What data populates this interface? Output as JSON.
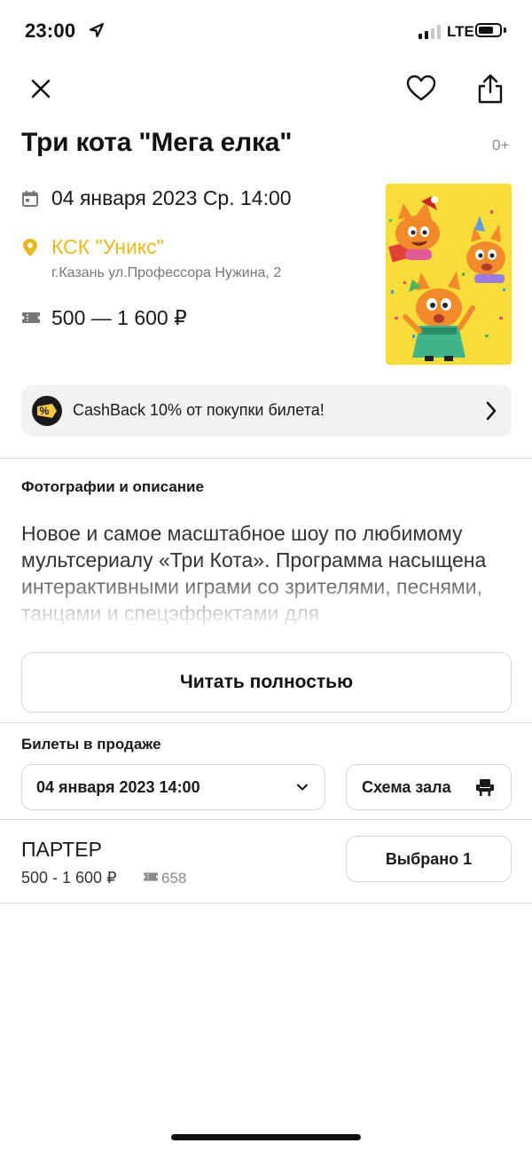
{
  "status_bar": {
    "time": "23:00",
    "network": "LTE"
  },
  "event": {
    "title": "Три кота \"Мега елка\"",
    "age_rating": "0+",
    "date": "04 января 2023 Ср. 14:00",
    "venue_name": "КСК \"Уникс\"",
    "venue_address": "г.Казань ул.Профессора Нужина, 2",
    "price_range": "500 — 1 600 ₽"
  },
  "cashback": {
    "text": "CashBack 10% от покупки билета!",
    "badge": "%"
  },
  "description": {
    "section_title": "Фотографии и описание",
    "text": "Новое и самое масштабное шоу по любимому мультсериалу «Три Кота». Программа насыщена интерактивными играми со зрителями, песнями, танцами и спецэффектами для",
    "read_more_label": "Читать полностью"
  },
  "tickets": {
    "section_title": "Билеты в продаже",
    "selected_date": "04 января 2023 14:00",
    "scheme_label": "Схема зала",
    "zones": [
      {
        "name": "ПАРТЕР",
        "price": "500 - 1 600 ₽",
        "available": "658",
        "button_label": "Выбрано 1"
      }
    ]
  },
  "colors": {
    "accent": "#e8b81d",
    "poster_bg": "#f7dc3a",
    "cashback_bg": "#f2f2f4",
    "divider": "#dcdcdc"
  }
}
